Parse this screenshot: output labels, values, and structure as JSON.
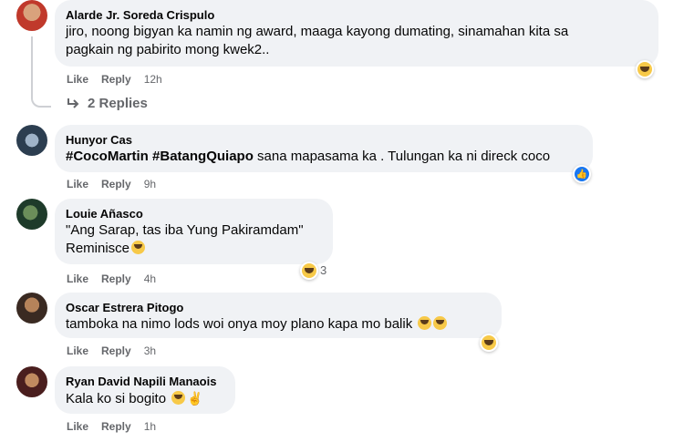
{
  "comments": [
    {
      "author": "Alarde Jr. Soreda Crispulo",
      "line1": "jiro, noong bigyan ka namin ng award, maaga kayong dumating, sinamahan kita sa",
      "line2": "pagkain ng pabirito mong kwek2..",
      "like": "Like",
      "reply": "Reply",
      "time": "12h",
      "replies": "2 Replies"
    },
    {
      "author": "Hunyor Cas",
      "tag1": "#CocoMartin",
      "tag2": "#BatangQuiapo",
      "text": " sana mapasama ka . Tulungan ka ni direck coco",
      "like": "Like",
      "reply": "Reply",
      "time": "9h"
    },
    {
      "author": "Louie Añasco",
      "line1": "\"Ang Sarap, tas iba Yung Pakiramdam\"",
      "line2": "Reminisce",
      "like": "Like",
      "reply": "Reply",
      "time": "4h",
      "reaction_count": "3"
    },
    {
      "author": "Oscar Estrera Pitogo",
      "text": "tamboka na nimo lods woi onya moy plano kapa mo balik",
      "like": "Like",
      "reply": "Reply",
      "time": "3h"
    },
    {
      "author": "Ryan David Napili Manaois",
      "text": "Kala ko si bogito",
      "like": "Like",
      "reply": "Reply",
      "time": "1h"
    }
  ],
  "icons": {
    "reply_arrow": "reply-arrow-icon",
    "grin_emoji": "grinning-face-icon",
    "victory_hand": "victory-hand-icon",
    "like_reaction": "like-thumb-icon"
  },
  "colors": {
    "bubble": "#f0f2f5",
    "meta": "#65676b",
    "like_blue": "#1877f2"
  }
}
